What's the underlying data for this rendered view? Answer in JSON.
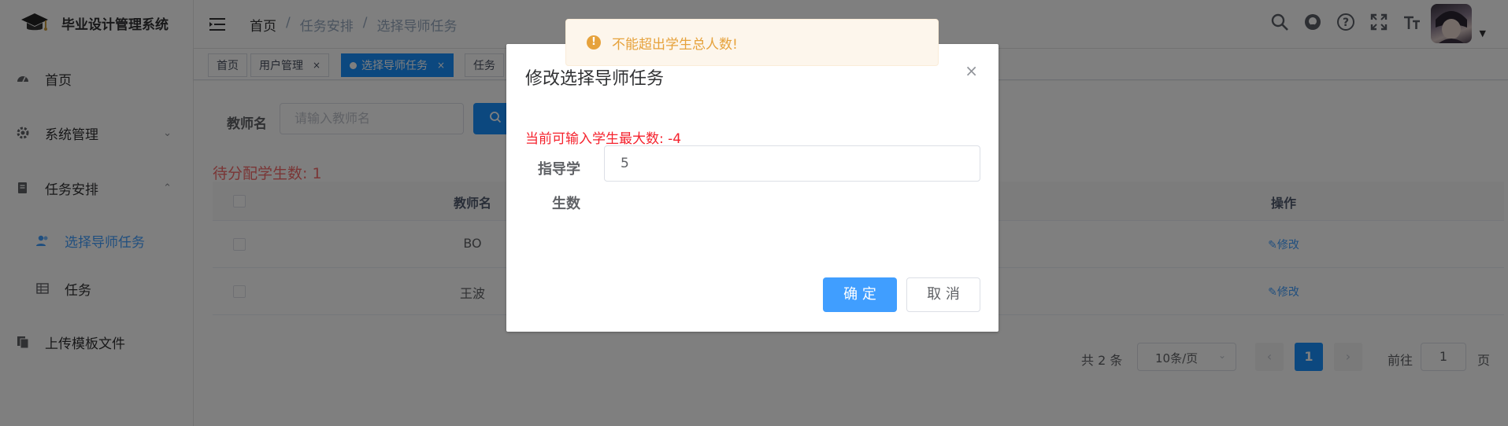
{
  "app": {
    "title": "毕业设计管理系统"
  },
  "sidebar": {
    "items": [
      {
        "label": "首页",
        "icon": "dashboard-icon"
      },
      {
        "label": "系统管理",
        "icon": "gear-icon",
        "arrow": "⌄"
      },
      {
        "label": "任务安排",
        "icon": "document-icon",
        "arrow": "⌃"
      },
      {
        "label": "选择导师任务",
        "icon": "users-icon",
        "active": true
      },
      {
        "label": "任务",
        "icon": "table-icon"
      },
      {
        "label": "上传模板文件",
        "icon": "files-icon"
      }
    ]
  },
  "header": {
    "breadcrumb": [
      "首页",
      "/",
      "任务安排",
      "/",
      "选择导师任务"
    ]
  },
  "tags": [
    {
      "label": "首页"
    },
    {
      "label": "用户管理",
      "close": "×"
    },
    {
      "label": "选择导师任务",
      "close": "×",
      "active": true
    },
    {
      "label": "任务"
    }
  ],
  "filter": {
    "label": "教师名",
    "placeholder": "请输入教师名"
  },
  "pending": "待分配学生数: 1",
  "table": {
    "headers": {
      "name": "教师名",
      "op": "操作"
    },
    "rows": [
      {
        "name": "BO",
        "op": "修改"
      },
      {
        "name": "王波",
        "op": "修改"
      }
    ]
  },
  "pager": {
    "total": "共 2 条",
    "size": "10条/页",
    "prev": "‹",
    "current": "1",
    "next": "›",
    "goto": "前往",
    "goto_value": "1",
    "unit": "页"
  },
  "dialog": {
    "title": "修改选择导师任务",
    "close": "×",
    "hint": "当前可输入学生最大数: -4",
    "label": "指导学生数",
    "value": "5",
    "ok": "确 定",
    "cancel": "取 消"
  },
  "toast": {
    "message": "不能超出学生总人数!",
    "icon": "!"
  },
  "colors": {
    "primary": "#1890ff",
    "button": "#409eff",
    "danger": "#f56c6c",
    "warning": "#e6a23c"
  }
}
